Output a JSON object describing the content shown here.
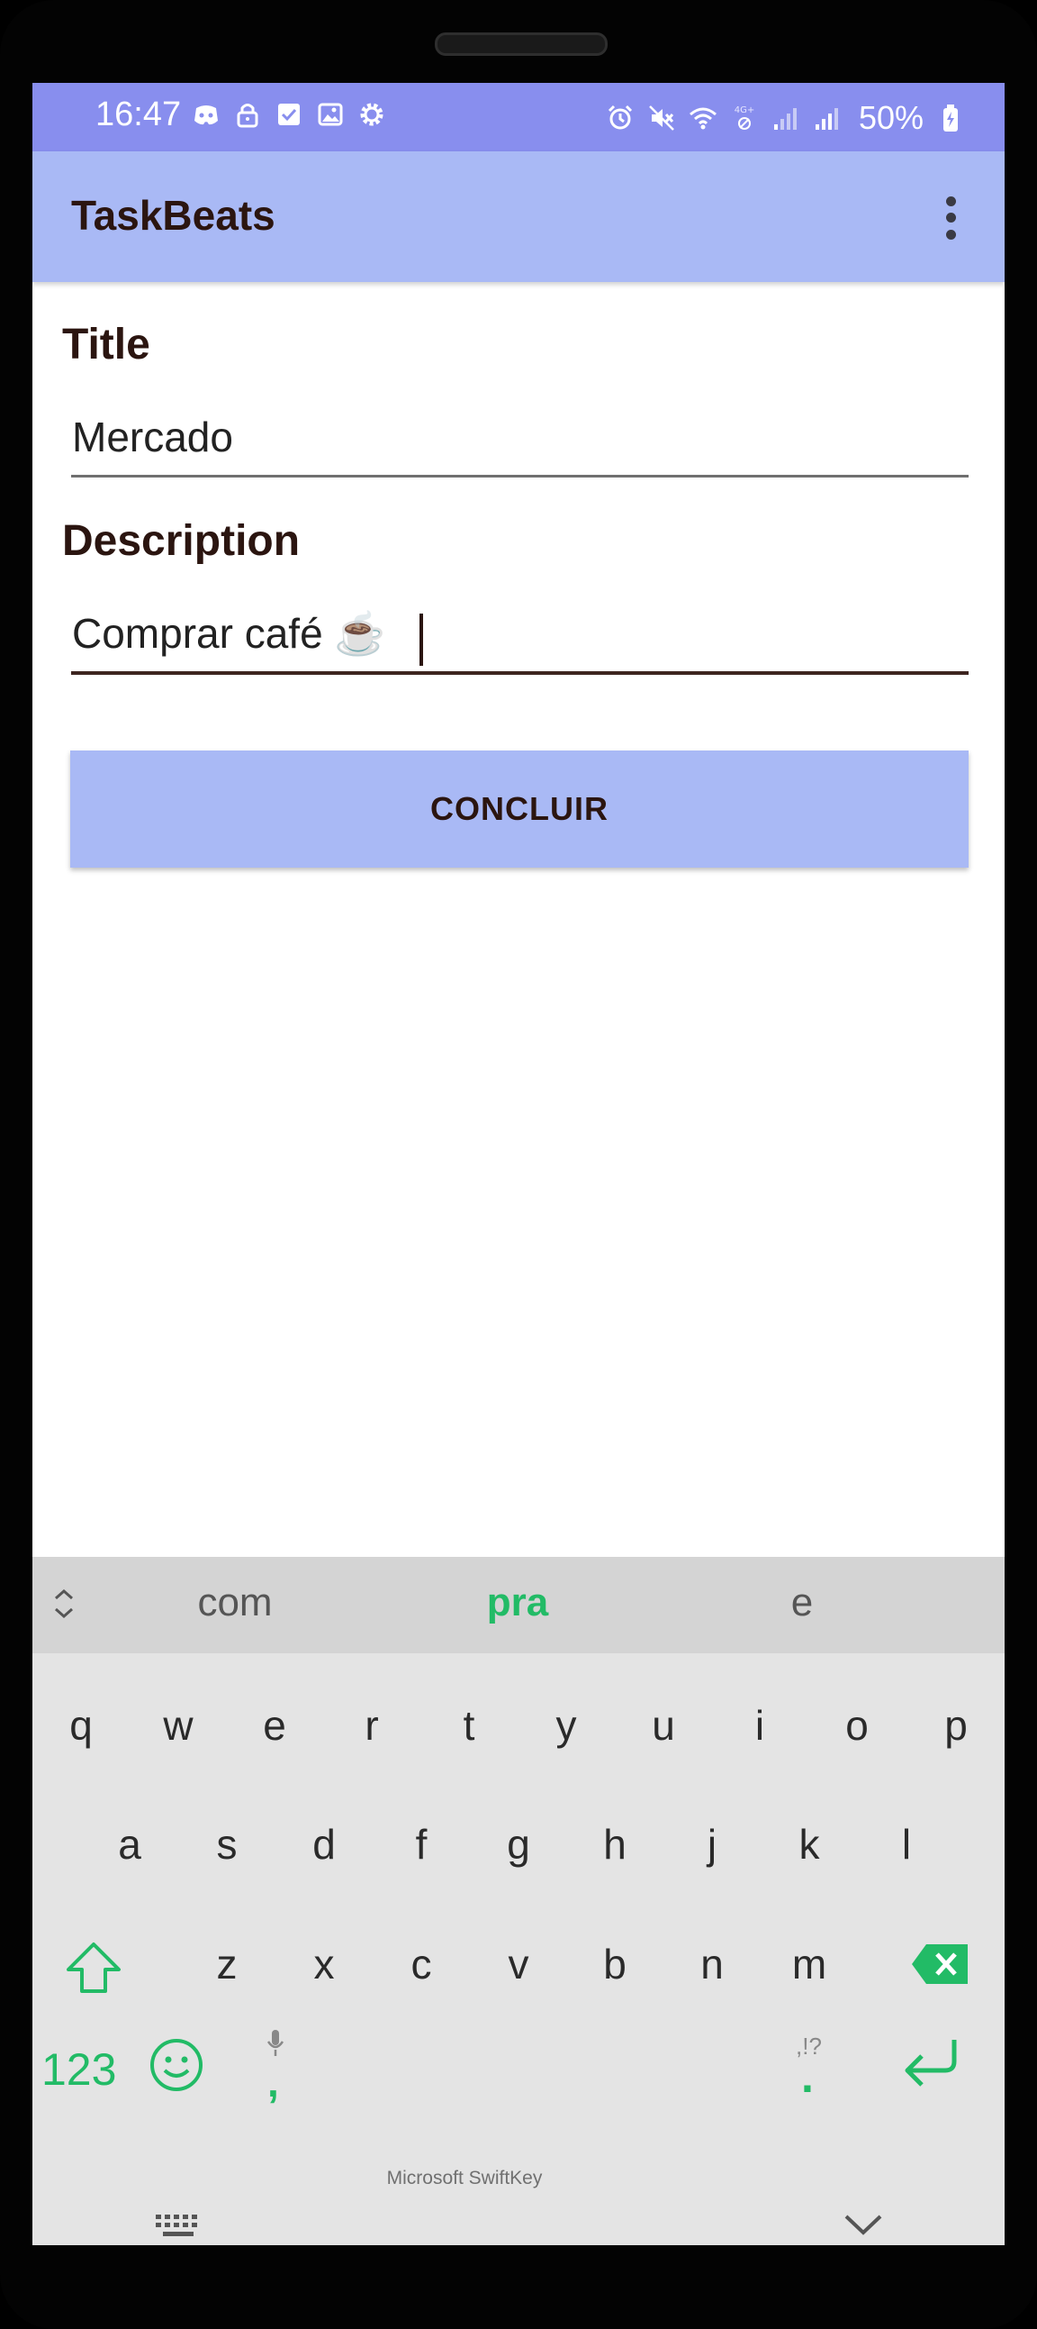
{
  "status_bar": {
    "time": "16:47",
    "battery": "50%",
    "left_icons": [
      "discord-icon",
      "lock-icon",
      "checkbox-icon",
      "image-icon",
      "settings-icon"
    ],
    "right_icons": [
      "alarm-icon",
      "mute-icon",
      "wifi-icon",
      "4g-icon",
      "signal-icon",
      "signal-icon"
    ]
  },
  "app_bar": {
    "title": "TaskBeats",
    "menu_icon": "more-vert-icon"
  },
  "form": {
    "title_label": "Title",
    "title_value": "Mercado",
    "description_label": "Description",
    "description_value": "Comprar café ☕",
    "submit_label": "CONCLUIR"
  },
  "keyboard": {
    "suggestions": [
      "com",
      "pra",
      "e"
    ],
    "row1": [
      "q",
      "w",
      "e",
      "r",
      "t",
      "y",
      "u",
      "i",
      "o",
      "p"
    ],
    "row2": [
      "a",
      "s",
      "d",
      "f",
      "g",
      "h",
      "j",
      "k",
      "l"
    ],
    "row3": [
      "z",
      "x",
      "c",
      "v",
      "b",
      "n",
      "m"
    ],
    "numbers_key": "123",
    "comma_key": ",",
    "space_label": "Microsoft SwiftKey",
    "punct_hint": ",!?",
    "period_key": ".",
    "accent_color": "#22BB66"
  },
  "colors": {
    "status_bar": "#888EEE",
    "app_bar": "#A9B9F5",
    "button": "#A9B9F5",
    "text_dark": "#2B1510"
  }
}
